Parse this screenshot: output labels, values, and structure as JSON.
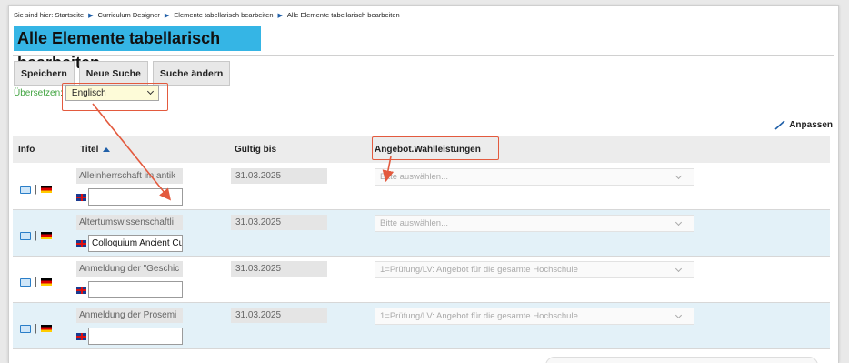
{
  "breadcrumb": {
    "prefix": "Sie sind hier:",
    "items": [
      "Startseite",
      "Curriculum Designer",
      "Elemente tabellarisch bearbeiten",
      "Alle Elemente tabellarisch bearbeiten"
    ]
  },
  "page": {
    "title": "Alle Elemente tabellarisch bearbeiten"
  },
  "toolbar": {
    "save_label": "Speichern",
    "new_search_label": "Neue Suche",
    "edit_search_label": "Suche ändern"
  },
  "translate": {
    "label": "Übersetzen:",
    "selected": "Englisch"
  },
  "customize": {
    "label": "Anpassen"
  },
  "table": {
    "headers": {
      "info": "Info",
      "title": "Titel",
      "valid_until": "Gültig bis",
      "offer": "Angebot.Wahlleistungen"
    },
    "rows": [
      {
        "title": "Alleinherrschaft im antik",
        "translation": "",
        "valid_until": "31.03.2025",
        "offer": "Bitte auswählen..."
      },
      {
        "title": "Altertumswissenschaftli",
        "translation": "Colloquium Ancient Cult",
        "valid_until": "31.03.2025",
        "offer": "Bitte auswählen..."
      },
      {
        "title": "Anmeldung der \"Geschic",
        "translation": "",
        "valid_until": "31.03.2025",
        "offer": "1=Prüfung/LV: Angebot für die gesamte Hochschule"
      },
      {
        "title": "Anmeldung der Prosemi",
        "translation": "",
        "valid_until": "31.03.2025",
        "offer": "1=Prüfung/LV: Angebot für die gesamte Hochschule"
      }
    ]
  },
  "colors": {
    "title_bg": "#35b5e5",
    "translate_label": "#3fa33f",
    "alt_row": "#e3f1f8",
    "annotation": "#e35a3e"
  }
}
